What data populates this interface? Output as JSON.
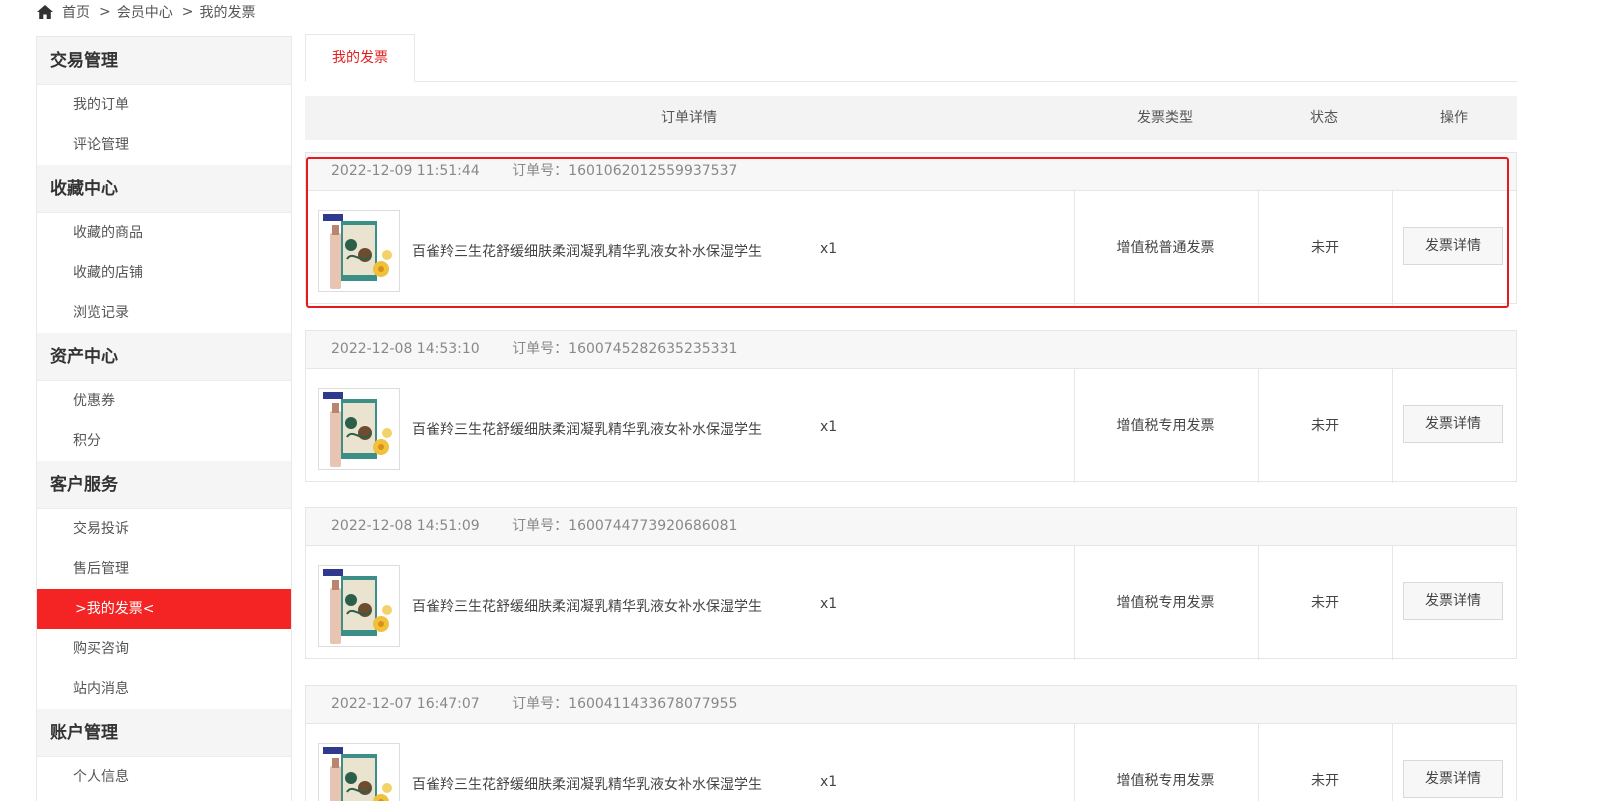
{
  "breadcrumb": {
    "icon": "home-icon",
    "items": [
      "首页",
      "会员中心",
      "我的发票"
    ],
    "separator": ">"
  },
  "sidebar": {
    "groups": [
      {
        "title": "交易管理",
        "items": [
          "我的订单",
          "评论管理"
        ]
      },
      {
        "title": "收藏中心",
        "items": [
          "收藏的商品",
          "收藏的店铺",
          "浏览记录"
        ]
      },
      {
        "title": "资产中心",
        "items": [
          "优惠券",
          "积分"
        ]
      },
      {
        "title": "客户服务",
        "items": [
          "交易投诉",
          "售后管理",
          ">我的发票<",
          "购买咨询",
          "站内消息"
        ]
      },
      {
        "title": "账户管理",
        "items": [
          "个人信息"
        ]
      }
    ],
    "active_item": ">我的发票<"
  },
  "tabs": [
    "我的发票"
  ],
  "table_headers": [
    "订单详情",
    "发票类型",
    "状态",
    "操作"
  ],
  "order_no_label": "订单号：",
  "orders": [
    {
      "time": "2022-12-09 11:51:44",
      "order_no": "1601062012559937537",
      "product": "百雀羚三生花舒缓细肤柔润凝乳精华乳液女补水保湿学生",
      "qty": "x1",
      "invoice_type": "增值税普通发票",
      "status": "未开",
      "action": "发票详情"
    },
    {
      "time": "2022-12-08 14:53:10",
      "order_no": "1600745282635235331",
      "product": "百雀羚三生花舒缓细肤柔润凝乳精华乳液女补水保湿学生",
      "qty": "x1",
      "invoice_type": "增值税专用发票",
      "status": "未开",
      "action": "发票详情"
    },
    {
      "time": "2022-12-08 14:51:09",
      "order_no": "1600744773920686081",
      "product": "百雀羚三生花舒缓细肤柔润凝乳精华乳液女补水保湿学生",
      "qty": "x1",
      "invoice_type": "增值税专用发票",
      "status": "未开",
      "action": "发票详情"
    },
    {
      "time": "2022-12-07 16:47:07",
      "order_no": "1600411433678077955",
      "product": "百雀羚三生花舒缓细肤柔润凝乳精华乳液女补水保湿学生",
      "qty": "x1",
      "invoice_type": "增值税专用发票",
      "status": "未开",
      "action": "发票详情"
    }
  ],
  "colors": {
    "accent": "#f42424",
    "highlight_border": "#e8191e",
    "tab_text": "#e02020"
  }
}
